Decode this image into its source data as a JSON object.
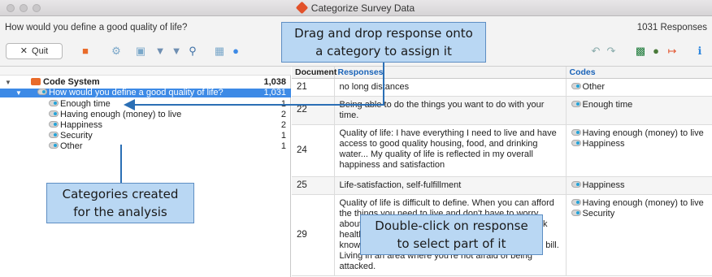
{
  "window": {
    "title": "Categorize Survey Data"
  },
  "header": {
    "question": "How would you define a good quality of life?",
    "responses_count": "1031 Responses",
    "quit_label": "Quit",
    "quit_icon": "close-icon"
  },
  "tree": {
    "root": {
      "label": "Code System",
      "count": "1,038"
    },
    "question": {
      "label": "How would you define a good quality of life?",
      "count": "1,031"
    },
    "codes": [
      {
        "label": "Enough time",
        "count": "1"
      },
      {
        "label": "Having enough (money) to live",
        "count": "2"
      },
      {
        "label": "Happiness",
        "count": "2"
      },
      {
        "label": "Security",
        "count": "1"
      },
      {
        "label": "Other",
        "count": "1"
      }
    ]
  },
  "table": {
    "headers": {
      "document": "Document",
      "responses": "Responses",
      "codes": "Codes"
    },
    "rows": [
      {
        "document": "21",
        "response": "no long distances",
        "codes": [
          "Other"
        ]
      },
      {
        "document": "22",
        "response": "Being able to do the things you want to do with your time.",
        "codes": [
          "Enough time"
        ]
      },
      {
        "document": "24",
        "response": "Quality of life: I have everything I need to live and have access to good quality housing, food, and drinking water... My quality of life is reflected in my overall happiness and satisfaction",
        "codes": [
          "Having enough (money) to live",
          "Happiness"
        ]
      },
      {
        "document": "25",
        "response": "Life-satisfaction, self-fulfillment",
        "codes": [
          "Happiness"
        ]
      },
      {
        "document": "29",
        "response": "Quality of life is difficult to define. When you can afford the things you need to live and don't have to worry about money. When you have time to relax and cook healthy meals. To have the security that comes with knowing that you can pay unexpected costs like the bill. Living in an area where you're not afraid of being attacked.",
        "codes": [
          "Having enough (money) to live",
          "Security"
        ]
      }
    ]
  },
  "callouts": {
    "drag_line1": "Drag and drop response onto",
    "drag_line2": "a category to assign it",
    "categories_line1": "Categories created",
    "categories_line2": "for the analysis",
    "double_line1": "Double-click on response",
    "double_line2": "to select part of it"
  },
  "colors": {
    "accent": "#3d8ae6",
    "callout_fill": "#b9d7f3",
    "callout_border": "#5e8ec3",
    "arrow": "#2b6fb5"
  }
}
